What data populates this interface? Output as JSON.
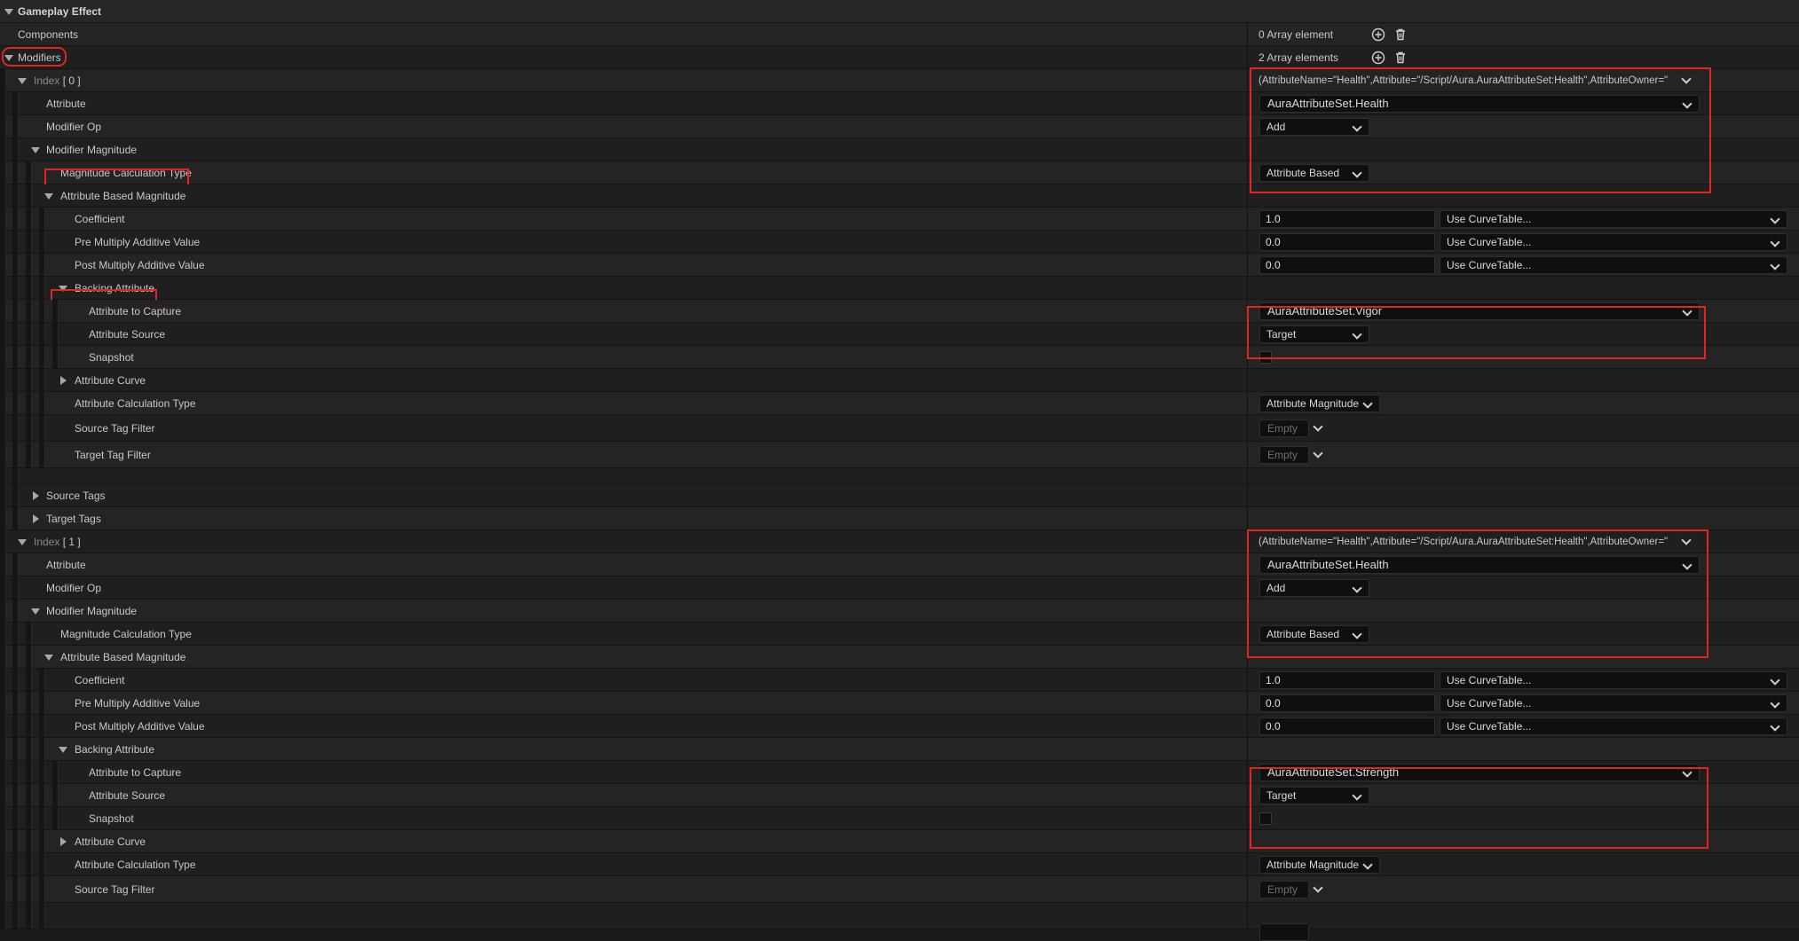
{
  "section_title": "Gameplay Effect",
  "components": {
    "label": "Components",
    "count_text": "0 Array element"
  },
  "modifiers": {
    "label": "Modifiers",
    "count_text": "2 Array elements"
  },
  "index0": {
    "label": "Index",
    "number": "[ 0 ]",
    "summary": "(AttributeName=\"Health\",Attribute=\"/Script/Aura.AuraAttributeSet:Health\",AttributeOwner=\"",
    "attribute_label": "Attribute",
    "attribute_value": "AuraAttributeSet.Health",
    "modifier_op_label": "Modifier Op",
    "modifier_op_value": "Add",
    "modifier_magnitude_label": "Modifier Magnitude",
    "calc_type_label": "Magnitude Calculation Type",
    "calc_type_value": "Attribute Based",
    "abm_label": "Attribute Based Magnitude",
    "coefficient_label": "Coefficient",
    "coefficient_value": "1.0",
    "pre_label": "Pre Multiply Additive Value",
    "pre_value": "0.0",
    "post_label": "Post Multiply Additive Value",
    "post_value": "0.0",
    "curve_table": "Use CurveTable...",
    "backing_label": "Backing Attribute",
    "capture_label": "Attribute to Capture",
    "capture_value": "AuraAttributeSet.Vigor",
    "source_label": "Attribute Source",
    "source_value": "Target",
    "snapshot_label": "Snapshot",
    "curve_label": "Attribute Curve",
    "attr_calc_label": "Attribute Calculation Type",
    "attr_calc_value": "Attribute Magnitude",
    "source_tag_filter_label": "Source Tag Filter",
    "target_tag_filter_label": "Target Tag Filter",
    "empty_text": "Empty",
    "source_tags_label": "Source Tags",
    "target_tags_label": "Target Tags"
  },
  "index1": {
    "label": "Index",
    "number": "[ 1 ]",
    "summary": "(AttributeName=\"Health\",Attribute=\"/Script/Aura.AuraAttributeSet:Health\",AttributeOwner=\"",
    "attribute_label": "Attribute",
    "attribute_value": "AuraAttributeSet.Health",
    "modifier_op_label": "Modifier Op",
    "modifier_op_value": "Add",
    "modifier_magnitude_label": "Modifier Magnitude",
    "calc_type_label": "Magnitude Calculation Type",
    "calc_type_value": "Attribute Based",
    "abm_label": "Attribute Based Magnitude",
    "coefficient_label": "Coefficient",
    "coefficient_value": "1.0",
    "pre_label": "Pre Multiply Additive Value",
    "pre_value": "0.0",
    "post_label": "Post Multiply Additive Value",
    "post_value": "0.0",
    "curve_table": "Use CurveTable...",
    "backing_label": "Backing Attribute",
    "capture_label": "Attribute to Capture",
    "capture_value": "AuraAttributeSet.Strength",
    "source_label": "Attribute Source",
    "source_value": "Target",
    "snapshot_label": "Snapshot",
    "curve_label": "Attribute Curve",
    "attr_calc_label": "Attribute Calculation Type",
    "attr_calc_value": "Attribute Magnitude",
    "source_tag_filter_label": "Source Tag Filter",
    "empty_text": "Empty"
  },
  "colors": {
    "highlight": "#e02424",
    "background": "#1b1b1b"
  },
  "icons": {
    "add": "add-circle-icon",
    "delete": "trash-icon"
  }
}
